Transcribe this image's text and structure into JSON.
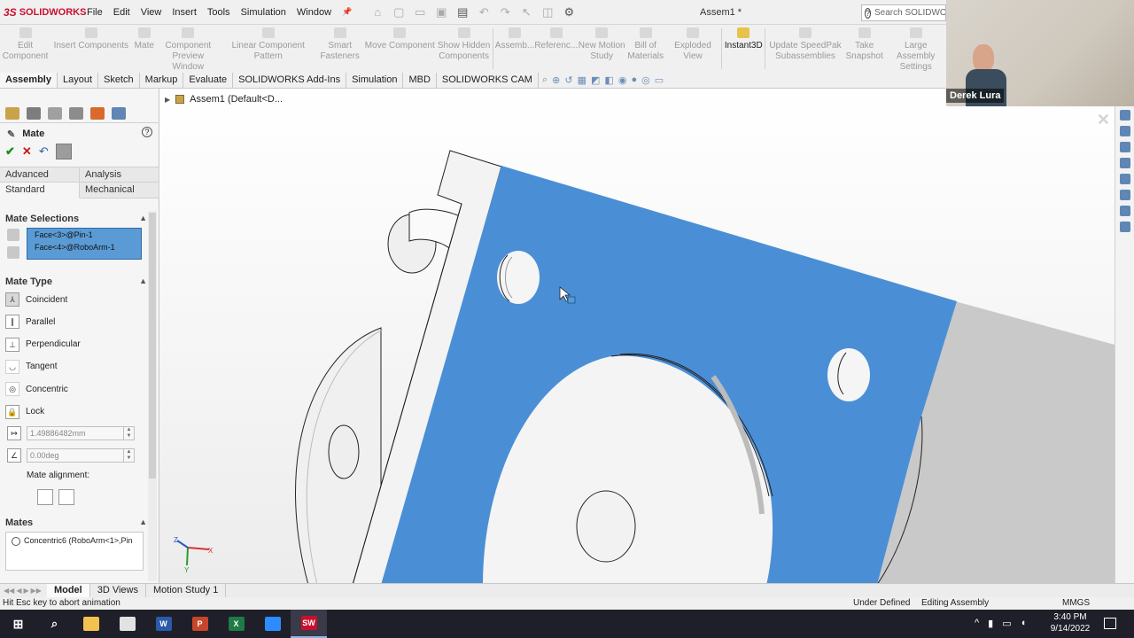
{
  "app": {
    "logo_text": "SOLIDWORKS",
    "doc_title": "Assem1 *",
    "menu": [
      "File",
      "Edit",
      "View",
      "Insert",
      "Tools",
      "Simulation",
      "Window"
    ],
    "search_placeholder": "Search SOLIDWORKS"
  },
  "ribbon": {
    "buttons": [
      {
        "label": "Edit\nComponent",
        "active": false
      },
      {
        "label": "Insert Components",
        "active": false
      },
      {
        "label": "Mate",
        "active": false
      },
      {
        "label": "Component\nPreview Window",
        "active": false
      },
      {
        "label": "Linear Component Pattern",
        "active": false
      },
      {
        "label": "Smart\nFasteners",
        "active": false
      },
      {
        "label": "Move Component",
        "active": false
      },
      {
        "label": "Show Hidden\nComponents",
        "active": false
      },
      {
        "label": "Assemb...",
        "active": false
      },
      {
        "label": "Referenc...",
        "active": false
      },
      {
        "label": "New Motion\nStudy",
        "active": false
      },
      {
        "label": "Bill of\nMaterials",
        "active": false
      },
      {
        "label": "Exploded View",
        "active": false
      },
      {
        "label": "Instant3D",
        "active": true
      },
      {
        "label": "Update SpeedPak\nSubassemblies",
        "active": false
      },
      {
        "label": "Take\nSnapshot",
        "active": false
      },
      {
        "label": "Large Assembly\nSettings",
        "active": false
      }
    ]
  },
  "command_tabs": [
    "Assembly",
    "Layout",
    "Sketch",
    "Markup",
    "Evaluate",
    "SOLIDWORKS Add-Ins",
    "Simulation",
    "MBD",
    "SOLIDWORKS CAM"
  ],
  "active_command_tab": "Assembly",
  "tree_path": "Assem1  (Default<D...",
  "webcam": {
    "name": "Derek Lura"
  },
  "property_manager": {
    "title": "Mate",
    "tabs_row1": [
      "Advanced",
      "Analysis"
    ],
    "tabs_row2": [
      "Standard",
      "Mechanical"
    ],
    "mate_selections": {
      "title": "Mate Selections",
      "items": [
        "Face<3>@Pin-1",
        "Face<4>@RoboArm-1"
      ]
    },
    "mate_type": {
      "title": "Mate Type",
      "options": [
        {
          "label": "Coincident",
          "icon": "coincident-icon",
          "selected": true,
          "dim": false
        },
        {
          "label": "Parallel",
          "icon": "parallel-icon",
          "selected": false,
          "dim": false
        },
        {
          "label": "Perpendicular",
          "icon": "perpendicular-icon",
          "selected": false,
          "dim": false
        },
        {
          "label": "Tangent",
          "icon": "tangent-icon",
          "selected": false,
          "dim": true
        },
        {
          "label": "Concentric",
          "icon": "concentric-icon",
          "selected": false,
          "dim": true
        },
        {
          "label": "Lock",
          "icon": "lock-icon",
          "selected": false,
          "dim": false
        }
      ],
      "distance_value": "1.49886482mm",
      "angle_value": "0.00deg",
      "alignment_label": "Mate alignment:"
    },
    "mates": {
      "title": "Mates",
      "items": [
        "Concentric6 (RoboArm<1>,Pin"
      ]
    }
  },
  "bottom_tabs": [
    "Model",
    "3D Views",
    "Motion Study 1"
  ],
  "active_bottom_tab": "Model",
  "status": {
    "message": "Hit Esc key to abort animation",
    "definition": "Under Defined",
    "mode": "Editing Assembly",
    "units": "MMGS"
  },
  "taskbar": {
    "apps": [
      {
        "name": "file-explorer-icon",
        "color": "#f2c14e",
        "glyph": ""
      },
      {
        "name": "chrome-icon",
        "color": "#e2e2e2",
        "glyph": ""
      },
      {
        "name": "word-icon",
        "color": "#2b5aa8",
        "glyph": "W"
      },
      {
        "name": "powerpoint-icon",
        "color": "#c8452a",
        "glyph": "P"
      },
      {
        "name": "excel-icon",
        "color": "#1f7a45",
        "glyph": "X"
      },
      {
        "name": "zoom-icon",
        "color": "#2d8cff",
        "glyph": ""
      },
      {
        "name": "solidworks-icon",
        "color": "#c8102e",
        "glyph": "SW"
      }
    ],
    "time": "3:40 PM",
    "date": "9/14/2022"
  },
  "colors": {
    "selected_face": "#4a8fd6",
    "part_body": "#f2f2f2",
    "selection_box": "#5b9bd5"
  }
}
